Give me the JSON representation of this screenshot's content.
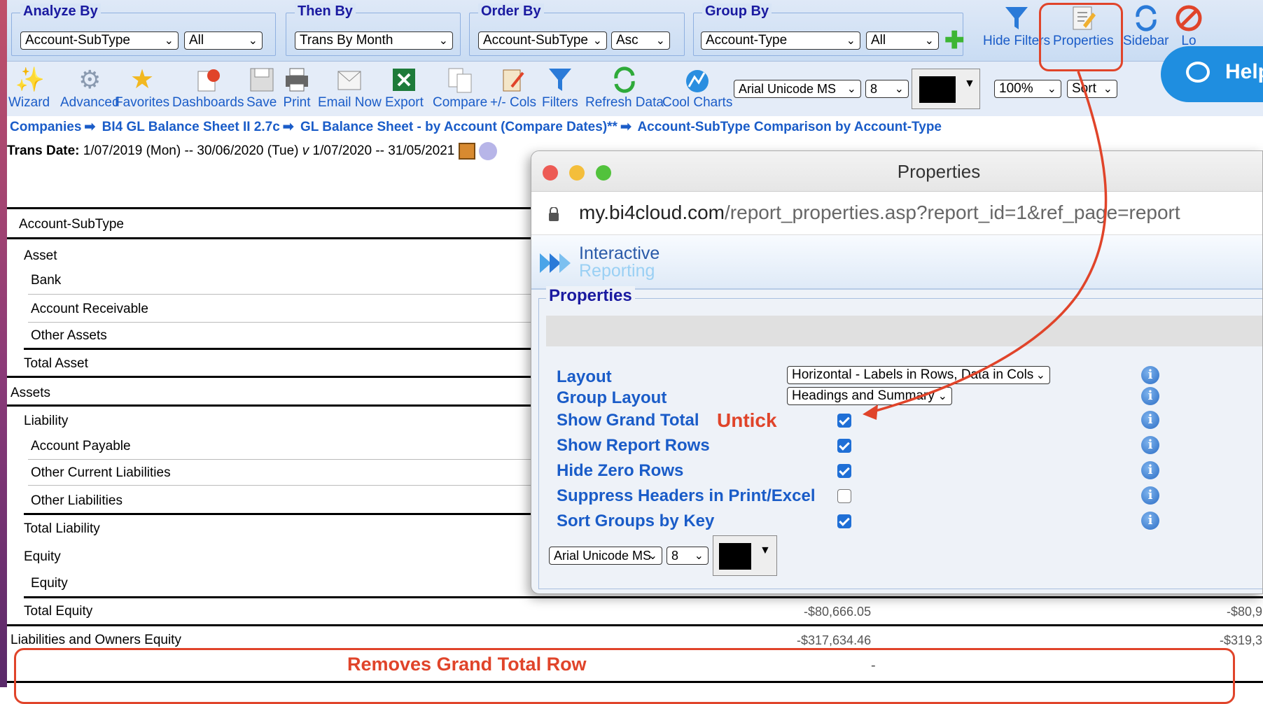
{
  "filters": {
    "analyze_by": {
      "legend": "Analyze By",
      "field": "Account-SubType",
      "value": "All"
    },
    "then_by": {
      "legend": "Then By",
      "field": "Trans By Month"
    },
    "order_by": {
      "legend": "Order By",
      "field": "Account-SubType",
      "dir": "Asc"
    },
    "group_by": {
      "legend": "Group By",
      "field": "Account-Type",
      "value": "All"
    },
    "right_tools": [
      "Hide Filters",
      "Properties",
      "Sidebar",
      "Lo"
    ]
  },
  "toolbar": {
    "items": [
      "Wizard",
      "Advanced",
      "Favorites",
      "Dashboards",
      "Save",
      "Print",
      "Email Now",
      "Export",
      "Compare",
      "+/- Cols",
      "Filters",
      "Refresh Data",
      "Cool Charts"
    ],
    "font": "Arial Unicode MS",
    "font_size": "8",
    "zoom": "100%",
    "sort": "Sort"
  },
  "help_button": "Help",
  "breadcrumb": [
    "Companies",
    "BI4 GL Balance Sheet II 2.7c",
    "GL Balance Sheet - by Account (Compare Dates)**",
    "Account-SubType Comparison by Account-Type"
  ],
  "trans_date": {
    "label": "Trans Date:",
    "range1": "1/07/2019 (Mon) -- 30/06/2020 (Tue)",
    "sep": "v",
    "range2": "1/07/2020 -- 31/05/2021"
  },
  "report": {
    "header": "Account-SubType",
    "rows": [
      "Asset",
      "Bank",
      "Account Receivable",
      "Other Assets",
      "Total Asset",
      "Assets",
      "Liability",
      "Account Payable",
      "Other Current Liabilities",
      "Other Liabilities",
      "Total Liability",
      "Equity",
      "Equity",
      "Total Equity",
      "Liabilities and Owners Equity"
    ],
    "total_equity_val1": "-$80,666.05",
    "total_equity_val2": "-$80,9",
    "liab_owners_val1": "-$317,634.46",
    "liab_owners_val2": "-$319,3",
    "grand_total_dash": "-"
  },
  "window": {
    "title": "Properties",
    "url_host": "my.bi4cloud.com",
    "url_path": "/report_properties.asp?report_id=1&ref_page=report",
    "brand_top": "Interactive",
    "brand_bottom": "Reporting",
    "section": "Properties",
    "layout_label": "Layout",
    "layout_value": "Horizontal - Labels in Rows, Data in Cols",
    "group_layout_label": "Group Layout",
    "group_layout_value": "Headings and Summary",
    "options": [
      {
        "label": "Show Grand Total",
        "checked": true
      },
      {
        "label": "Show Report Rows",
        "checked": true
      },
      {
        "label": "Hide Zero Rows",
        "checked": true
      },
      {
        "label": "Suppress Headers in Print/Excel",
        "checked": false
      },
      {
        "label": "Sort Groups by Key",
        "checked": true
      }
    ],
    "font": "Arial Unicode MS",
    "font_size": "8"
  },
  "annotations": {
    "untick": "Untick",
    "removes": "Removes Grand Total Row"
  },
  "colors": {
    "accent": "#1a5cc8",
    "annotation": "#e0442a",
    "checkbox": "#1f6fd6"
  }
}
